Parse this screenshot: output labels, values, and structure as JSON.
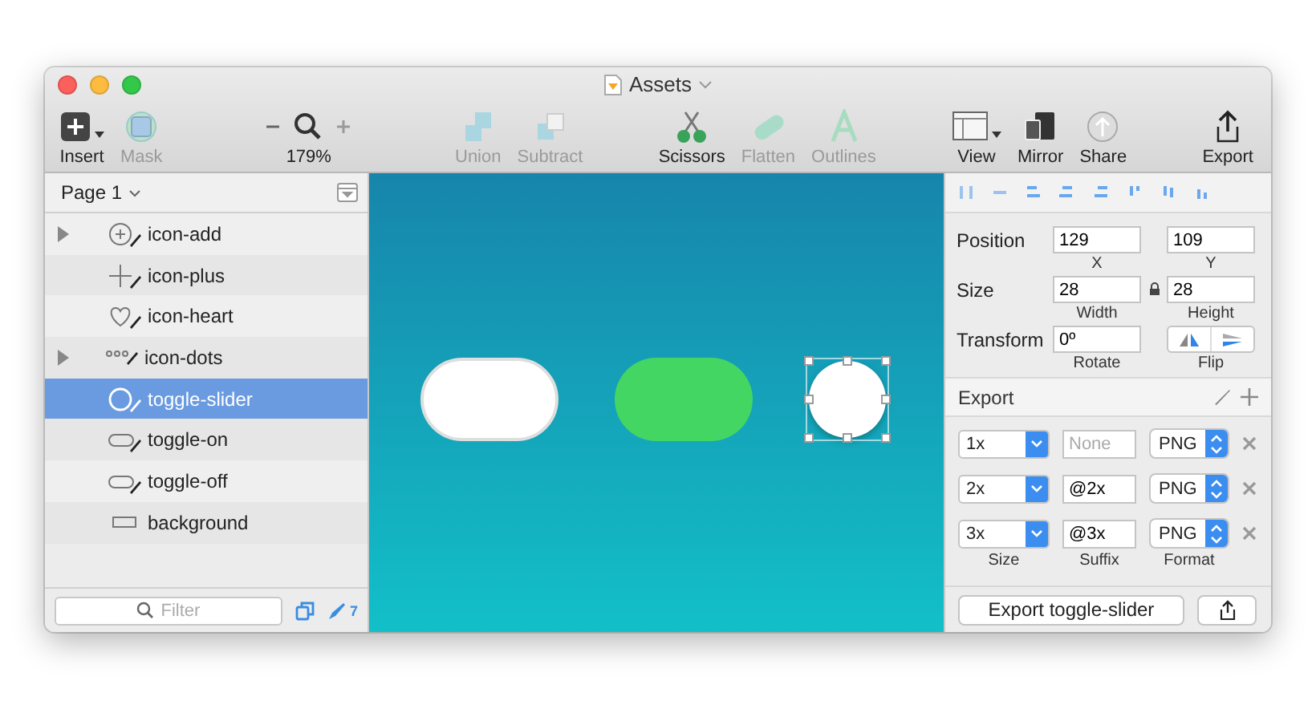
{
  "window": {
    "title": "Assets"
  },
  "toolbar": [
    {
      "items": [
        {
          "kind": "button",
          "label": "Insert",
          "disabled": false,
          "menu": true
        },
        {
          "kind": "button",
          "label": "Mask",
          "disabled": true,
          "menu": false
        }
      ]
    },
    {
      "items": [
        {
          "kind": "zoom",
          "label": "179%"
        }
      ]
    },
    {
      "items": [
        {
          "kind": "button",
          "label": "Union",
          "disabled": true,
          "menu": false
        },
        {
          "kind": "button",
          "label": "Subtract",
          "disabled": true,
          "menu": false
        }
      ]
    },
    {
      "items": [
        {
          "kind": "button",
          "label": "Scissors",
          "disabled": false,
          "menu": false
        },
        {
          "kind": "button",
          "label": "Flatten",
          "disabled": true,
          "menu": false
        },
        {
          "kind": "button",
          "label": "Outlines",
          "disabled": true,
          "menu": false
        }
      ]
    },
    {
      "items": [
        {
          "kind": "button",
          "label": "View",
          "disabled": false,
          "menu": true
        },
        {
          "kind": "button",
          "label": "Mirror",
          "disabled": false,
          "menu": false
        },
        {
          "kind": "button",
          "label": "Share",
          "disabled": false,
          "menu": false
        }
      ]
    },
    {
      "items": [
        {
          "kind": "button",
          "label": "Export",
          "disabled": false,
          "menu": false
        }
      ]
    }
  ],
  "layers": {
    "page": "Page 1",
    "items": [
      {
        "name": "icon-add",
        "expandable": true,
        "selected": false
      },
      {
        "name": "icon-plus",
        "expandable": false,
        "selected": false
      },
      {
        "name": "icon-heart",
        "expandable": false,
        "selected": false
      },
      {
        "name": "icon-dots",
        "expandable": true,
        "selected": false
      },
      {
        "name": "toggle-slider",
        "expandable": false,
        "selected": true
      },
      {
        "name": "toggle-on",
        "expandable": false,
        "selected": false
      },
      {
        "name": "toggle-off",
        "expandable": false,
        "selected": false
      },
      {
        "name": "background",
        "expandable": false,
        "selected": false
      }
    ],
    "filter": {
      "placeholder": "Filter"
    },
    "count": "7"
  },
  "canvas": {
    "shapes": [
      {
        "kind": "toggle-off",
        "selected": false
      },
      {
        "kind": "toggle-on",
        "selected": false
      },
      {
        "kind": "slider",
        "selected": true
      }
    ]
  },
  "inspector": {
    "rows": [
      {
        "kind": "pair",
        "label": "Position",
        "locked": false,
        "fields": [
          {
            "value": "129",
            "caption": "X"
          },
          {
            "value": "109",
            "caption": "Y"
          }
        ]
      },
      {
        "kind": "pair",
        "label": "Size",
        "locked": true,
        "fields": [
          {
            "value": "28",
            "caption": "Width"
          },
          {
            "value": "28",
            "caption": "Height"
          }
        ]
      },
      {
        "kind": "transform",
        "label": "Transform",
        "fields": [
          {
            "value": "0º",
            "caption": "Rotate"
          }
        ],
        "flip": "Flip"
      }
    ],
    "export": {
      "title": "Export",
      "rows": [
        {
          "size": "1x",
          "suffix_placeholder": "None",
          "format": "PNG"
        },
        {
          "size": "2x",
          "suffix": "@2x",
          "format": "PNG"
        },
        {
          "size": "3x",
          "suffix": "@3x",
          "format": "PNG"
        }
      ],
      "columns": [
        "Size",
        "Suffix",
        "Format"
      ],
      "button": "Export toggle-slider"
    }
  }
}
